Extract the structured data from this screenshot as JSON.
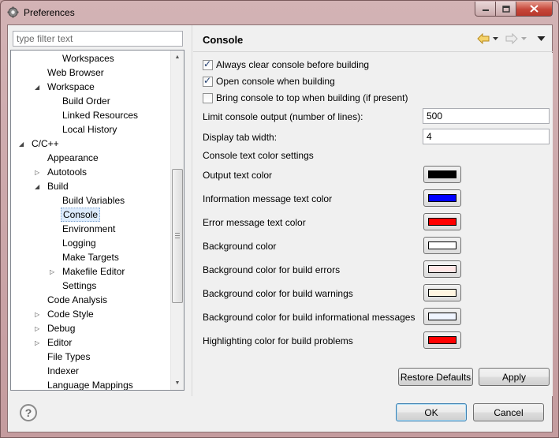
{
  "window": {
    "title": "Preferences"
  },
  "filter": {
    "placeholder": "type filter text"
  },
  "tree": [
    {
      "label": "Workspaces",
      "level": 2,
      "twisty": "none"
    },
    {
      "label": "Web Browser",
      "level": 1,
      "twisty": "none"
    },
    {
      "label": "Workspace",
      "level": 1,
      "twisty": "expanded"
    },
    {
      "label": "Build Order",
      "level": 2,
      "twisty": "none"
    },
    {
      "label": "Linked Resources",
      "level": 2,
      "twisty": "none"
    },
    {
      "label": "Local History",
      "level": 2,
      "twisty": "none"
    },
    {
      "label": "C/C++",
      "level": 0,
      "twisty": "expanded"
    },
    {
      "label": "Appearance",
      "level": 1,
      "twisty": "none"
    },
    {
      "label": "Autotools",
      "level": 1,
      "twisty": "collapsed"
    },
    {
      "label": "Build",
      "level": 1,
      "twisty": "expanded"
    },
    {
      "label": "Build Variables",
      "level": 2,
      "twisty": "none"
    },
    {
      "label": "Console",
      "level": 2,
      "twisty": "none",
      "selected": true
    },
    {
      "label": "Environment",
      "level": 2,
      "twisty": "none"
    },
    {
      "label": "Logging",
      "level": 2,
      "twisty": "none"
    },
    {
      "label": "Make Targets",
      "level": 2,
      "twisty": "none"
    },
    {
      "label": "Makefile Editor",
      "level": 2,
      "twisty": "collapsed"
    },
    {
      "label": "Settings",
      "level": 2,
      "twisty": "none"
    },
    {
      "label": "Code Analysis",
      "level": 1,
      "twisty": "none"
    },
    {
      "label": "Code Style",
      "level": 1,
      "twisty": "collapsed"
    },
    {
      "label": "Debug",
      "level": 1,
      "twisty": "collapsed"
    },
    {
      "label": "Editor",
      "level": 1,
      "twisty": "collapsed"
    },
    {
      "label": "File Types",
      "level": 1,
      "twisty": "none"
    },
    {
      "label": "Indexer",
      "level": 1,
      "twisty": "none"
    },
    {
      "label": "Language Mappings",
      "level": 1,
      "twisty": "none"
    }
  ],
  "page": {
    "title": "Console",
    "checkboxes": [
      {
        "label": "Always clear console before building",
        "checked": true
      },
      {
        "label": "Open console when building",
        "checked": true
      },
      {
        "label": "Bring console to top when building (if present)",
        "checked": false
      }
    ],
    "fields": [
      {
        "label": "Limit console output (number of lines):",
        "value": "500"
      },
      {
        "label": "Display tab width:",
        "value": "4"
      }
    ],
    "color_section_label": "Console text color settings",
    "colors": [
      {
        "label": "Output text color",
        "color": "#000000"
      },
      {
        "label": "Information message text color",
        "color": "#0000ff"
      },
      {
        "label": "Error message text color",
        "color": "#ff0000"
      },
      {
        "label": "Background color",
        "color": "#ffffff"
      },
      {
        "label": "Background color for build errors",
        "color": "#ffe6e6"
      },
      {
        "label": "Background color for build warnings",
        "color": "#fff5e1"
      },
      {
        "label": "Background color for build informational messages",
        "color": "#f0f5ff"
      },
      {
        "label": "Highlighting color for build problems",
        "color": "#ff0000"
      }
    ],
    "restore_label": "Restore Defaults",
    "apply_label": "Apply"
  },
  "dialog": {
    "ok_label": "OK",
    "cancel_label": "Cancel"
  },
  "icons": {
    "app": "preferences-gear-icon",
    "back": "back-arrow-icon",
    "forward": "forward-arrow-icon",
    "menu": "view-menu-icon",
    "help": "help-icon"
  }
}
